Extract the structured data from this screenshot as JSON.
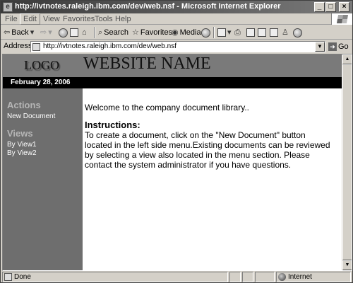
{
  "window": {
    "title": "http://ivtnotes.raleigh.ibm.com/dev/web.nsf - Microsoft Internet Explorer",
    "app_icon": "e",
    "buttons": {
      "minimize": "_",
      "maximize": "□",
      "close": "×"
    }
  },
  "menu": [
    "File",
    "Edit",
    "View",
    "Favorites",
    "Tools",
    "Help"
  ],
  "toolbar": {
    "back": "Back",
    "search": "Search",
    "favorites": "Favorites",
    "media": "Media"
  },
  "address": {
    "label": "Address",
    "url": "http://ivtnotes.raleigh.ibm.com/dev/web.nsf",
    "go": "Go"
  },
  "page": {
    "logo": "LOGO",
    "site_name": "WEBSITE NAME",
    "date": "February 28, 2006",
    "sidebar": {
      "actions_heading": "Actions",
      "actions": [
        "New Document"
      ],
      "views_heading": "Views",
      "views": [
        "By View1",
        "By View2"
      ]
    },
    "welcome": "Welcome to the company document library..",
    "instructions_heading": "Instructions:",
    "instructions_body": "To create a document, click on the \"New Document\" button located in the left side menu.Existing documents can be reviewed by selecting a view also located in the menu section. Please contact the system administrator if you have questions."
  },
  "status": {
    "text": "Done",
    "zone": "Internet"
  },
  "colors": {
    "header_bg": "#7a7a7a",
    "sidebar_bg": "#6e6e6e",
    "date_bar_bg": "#000000"
  }
}
